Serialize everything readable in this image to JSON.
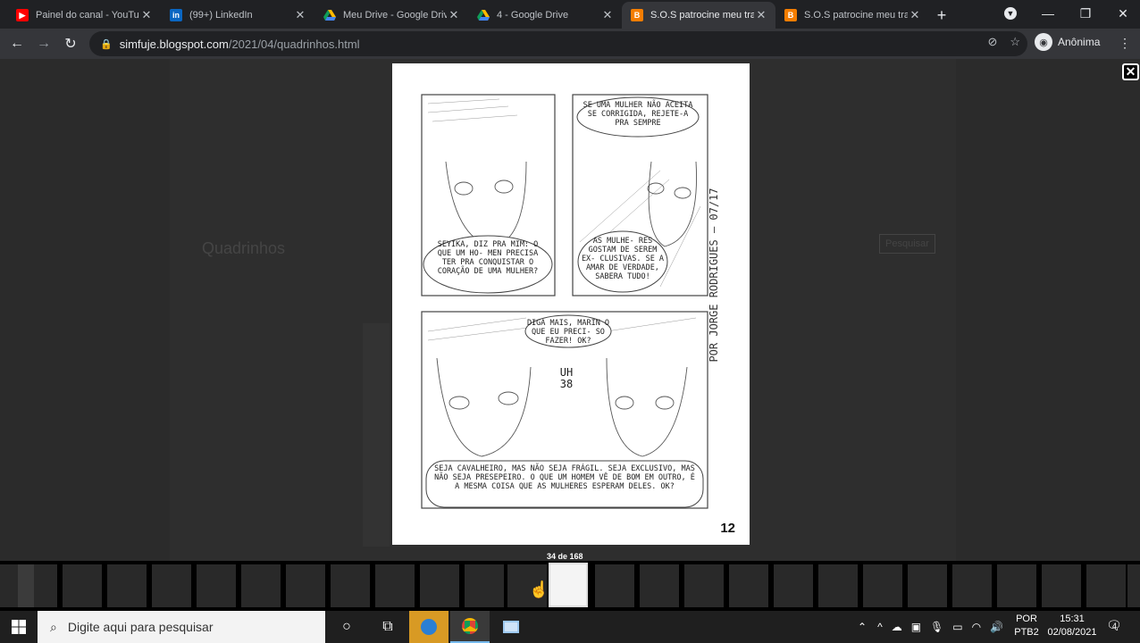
{
  "tabs": [
    {
      "title": "Painel do canal - YouTube",
      "favicon": "youtube-icon",
      "color": "#ff0000",
      "active": false
    },
    {
      "title": "(99+) LinkedIn",
      "favicon": "linkedin-icon",
      "color": "#0a66c2",
      "active": false
    },
    {
      "title": "Meu Drive - Google Drive",
      "favicon": "google-drive-icon",
      "color": "#34a853",
      "active": false
    },
    {
      "title": "4 - Google Drive",
      "favicon": "google-drive-icon",
      "color": "#34a853",
      "active": false
    },
    {
      "title": "S.O.S patrocine meu trabalho",
      "favicon": "blogger-icon",
      "color": "#f57d00",
      "active": true
    },
    {
      "title": "S.O.S patrocine meu trabalho",
      "favicon": "blogger-icon",
      "color": "#f57d00",
      "active": false
    }
  ],
  "address": {
    "host": "simfuje.blogspot.com",
    "path": "/2021/04/quadrinhos.html"
  },
  "profile": {
    "label": "Anônima"
  },
  "blog": {
    "title": "Quadrinhos",
    "search_button": "Pesquisar"
  },
  "comic": {
    "page_number": "12",
    "bubbles": {
      "b1": "SEYIKA, DIZ PRA MIM: O QUE UM HO- MEN PRECISA TER PRA CONQUISTAR O CORAÇÃO DE UMA MULHER?",
      "b2": "SE UMA MULHER NÃO ACEITA SE CORRIGIDA, REJETE-A PRA SEMPRE",
      "b3": "AS MULHE- RES GOSTAM DE SEREM EX- CLUSIVAS. SE A AMAR DE VERDADE, SABERA TUDO!",
      "b4": "DIGA MAIS, MARIN O QUE EU PRECI- SO FAZER! OK?",
      "b5": "SEJA CAVALHEIRO, MAS NÃO SEJA FRÁGIL. SEJA EXCLUSIVO, MAS NÃO SEJA PRESEPEIRO. O QUE UM HOMEM VÊ DE BOM EM OUTRO, É A MESMA COISA QUE AS MULHERES ESPERAM DELES. OK?",
      "sfx": "UH 38"
    },
    "signature": "POR JORGE RODRIGUES — 07/17"
  },
  "viewer": {
    "counter": "34 de 168"
  },
  "taskbar": {
    "search_placeholder": "Digite aqui para pesquisar",
    "lang_top": "POR",
    "lang_bottom": "PTB2",
    "time": "15:31",
    "date": "02/08/2021",
    "notifications": "4"
  }
}
